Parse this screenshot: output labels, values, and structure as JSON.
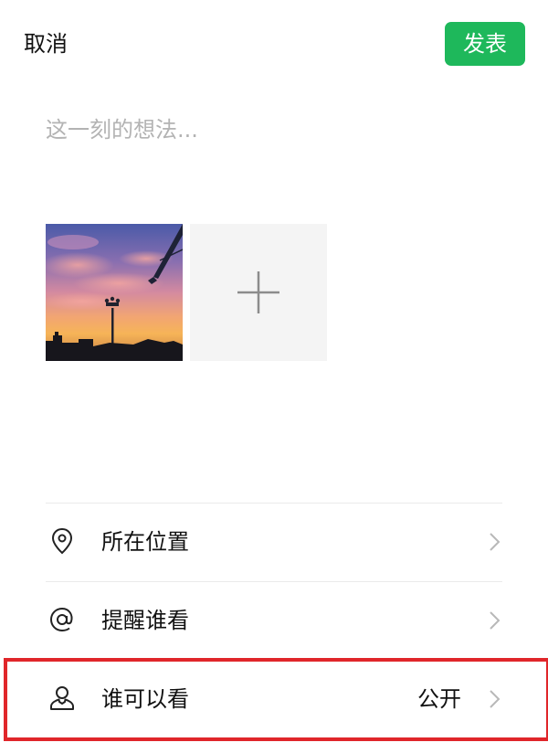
{
  "colors": {
    "accent": "#1eb85b",
    "highlight": "#e0262a",
    "divider": "#eaeaea"
  },
  "header": {
    "cancel_label": "取消",
    "publish_label": "发表"
  },
  "composer": {
    "placeholder": "这一刻的想法...",
    "value": ""
  },
  "media": {
    "photo_count": 1,
    "photo_icon": "sunset-photo",
    "add_icon": "plus-icon"
  },
  "options": [
    {
      "icon": "location-pin-icon",
      "label": "所在位置",
      "value": ""
    },
    {
      "icon": "at-sign-icon",
      "label": "提醒谁看",
      "value": ""
    },
    {
      "icon": "person-icon",
      "label": "谁可以看",
      "value": "公开"
    }
  ]
}
